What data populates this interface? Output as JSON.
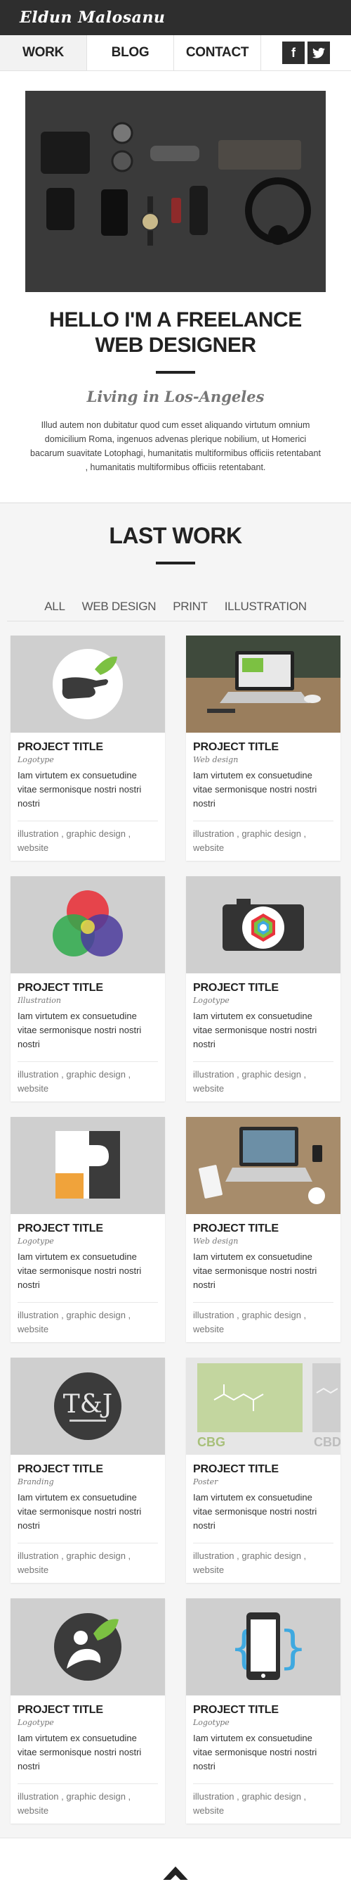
{
  "header": {
    "logo": "Eldun Malosanu"
  },
  "nav": {
    "items": [
      {
        "label": "WORK"
      },
      {
        "label": "BLOG"
      },
      {
        "label": "CONTACT"
      }
    ],
    "social": [
      {
        "label": "f",
        "icon": "facebook-icon"
      },
      {
        "label": "t",
        "icon": "twitter-icon"
      }
    ]
  },
  "hero": {
    "title": "HELLO I'M A FREELANCE WEB DESIGNER",
    "subtitle": "Living in Los-Angeles",
    "text": "Illud autem non dubitatur quod cum esset aliquando virtutum omnium domicilium Roma, ingenuos advenas plerique nobilium, ut Homerici bacarum suavitate Lotophagi, humanitatis multiformibus officiis retentabant , humanitatis multiformibus officiis retentabant."
  },
  "work": {
    "title": "LAST WORK",
    "filters": [
      "ALL",
      "WEB DESIGN",
      "PRINT",
      "ILLUSTRATION"
    ],
    "projects": [
      {
        "title": "PROJECT TITLE",
        "category": "Logotype",
        "desc": "Iam virtutem ex consuetudine vitae sermonisque nostri nostri nostri",
        "tags": "illustration , graphic design , website",
        "thumb": "hand-leaf-logo"
      },
      {
        "title": "PROJECT TITLE",
        "category": "Web design",
        "desc": "Iam virtutem ex consuetudine vitae sermonisque nostri nostri nostri",
        "tags": "illustration , graphic design , website",
        "thumb": "laptop-photo"
      },
      {
        "title": "PROJECT TITLE",
        "category": "Illustration",
        "desc": "Iam virtutem ex consuetudine vitae sermonisque nostri nostri nostri",
        "tags": "illustration , graphic design , website",
        "thumb": "rgb-circles"
      },
      {
        "title": "PROJECT TITLE",
        "category": "Logotype",
        "desc": "Iam virtutem ex consuetudine vitae sermonisque nostri nostri nostri",
        "tags": "illustration , graphic design , website",
        "thumb": "camera-logo"
      },
      {
        "title": "PROJECT TITLE",
        "category": "Logotype",
        "desc": "Iam virtutem ex consuetudine vitae sermonisque nostri nostri nostri",
        "tags": "illustration , graphic design , website",
        "thumb": "r-logo"
      },
      {
        "title": "PROJECT TITLE",
        "category": "Web design",
        "desc": "Iam virtutem ex consuetudine vitae sermonisque nostri nostri nostri",
        "tags": "illustration , graphic design , website",
        "thumb": "desk-photo"
      },
      {
        "title": "PROJECT TITLE",
        "category": "Branding",
        "desc": "Iam virtutem ex consuetudine vitae sermonisque nostri nostri nostri",
        "tags": "illustration , graphic design , website",
        "thumb": "tj-monogram"
      },
      {
        "title": "PROJECT TITLE",
        "category": "Poster",
        "desc": "Iam virtutem ex consuetudine vitae sermonisque nostri nostri nostri",
        "tags": "illustration , graphic design , website",
        "thumb": "cbg-poster",
        "thumb_text": "CBG",
        "thumb_text2": "CBDV"
      },
      {
        "title": "PROJECT TITLE",
        "category": "Logotype",
        "desc": "Iam virtutem ex consuetudine vitae sermonisque nostri nostri nostri",
        "tags": "illustration , graphic design , website",
        "thumb": "person-leaf-logo"
      },
      {
        "title": "PROJECT TITLE",
        "category": "Logotype",
        "desc": "Iam virtutem ex consuetudine vitae sermonisque nostri nostri nostri",
        "tags": "illustration , graphic design , website",
        "thumb": "phone-braces-logo"
      }
    ]
  },
  "footer": {
    "icon": "up-arrow-icon"
  },
  "colors": {
    "dark": "#2e2e2e",
    "thumb_bg": "#cfcfcf",
    "accent_orange": "#f0a33b",
    "accent_green": "#7cc142",
    "accent_blue": "#3fa9e0"
  }
}
